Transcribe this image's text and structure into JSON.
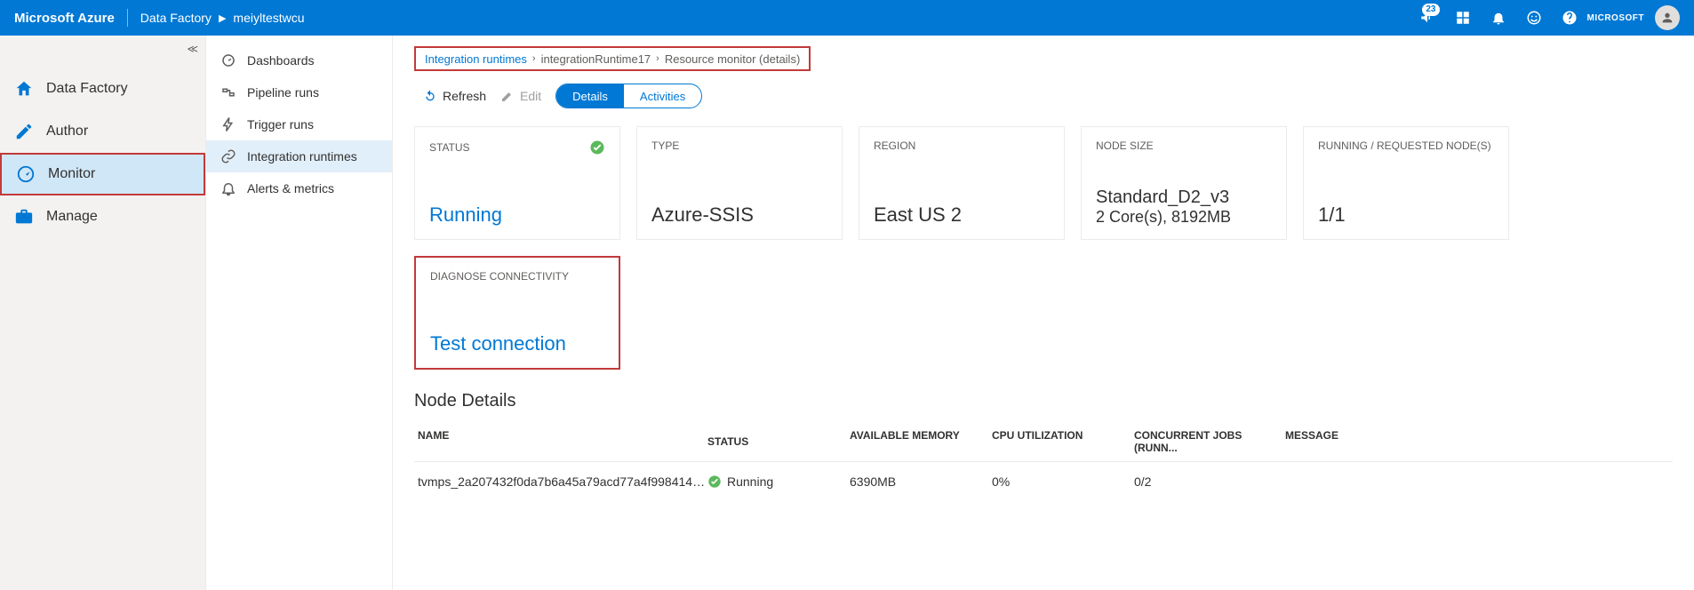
{
  "header": {
    "logo": "Microsoft Azure",
    "service": "Data Factory",
    "instance": "meiyltestwcu",
    "badge_count": "23",
    "tenant": "MICROSOFT"
  },
  "nav1": {
    "items": [
      {
        "label": "Data Factory"
      },
      {
        "label": "Author"
      },
      {
        "label": "Monitor"
      },
      {
        "label": "Manage"
      }
    ]
  },
  "nav2": {
    "items": [
      {
        "label": "Dashboards"
      },
      {
        "label": "Pipeline runs"
      },
      {
        "label": "Trigger runs"
      },
      {
        "label": "Integration runtimes"
      },
      {
        "label": "Alerts & metrics"
      }
    ]
  },
  "breadcrumb": {
    "a": "Integration runtimes",
    "b": "integrationRuntime17",
    "c": "Resource monitor (details)"
  },
  "toolbar": {
    "refresh": "Refresh",
    "edit": "Edit",
    "details": "Details",
    "activities": "Activities"
  },
  "cards": {
    "status_label": "STATUS",
    "status_value": "Running",
    "type_label": "TYPE",
    "type_value": "Azure-SSIS",
    "region_label": "REGION",
    "region_value": "East US 2",
    "nodesize_label": "NODE SIZE",
    "nodesize_value": "Standard_D2_v3",
    "nodesize_sub": "2 Core(s), 8192MB",
    "nodes_label": "RUNNING / REQUESTED NODE(S)",
    "nodes_value": "1/1",
    "diag_label": "DIAGNOSE CONNECTIVITY",
    "diag_value": "Test connection"
  },
  "node_details": {
    "title": "Node Details",
    "headers": {
      "name": "NAME",
      "status": "STATUS",
      "mem": "AVAILABLE MEMORY",
      "cpu": "CPU UTILIZATION",
      "jobs": "CONCURRENT JOBS (RUNN...",
      "msg": "MESSAGE"
    },
    "rows": [
      {
        "name": "tvmps_2a207432f0da7b6a45a79acd77a4f9984145...",
        "status": "Running",
        "mem": "6390MB",
        "cpu": "0%",
        "jobs": "0/2",
        "msg": ""
      }
    ]
  }
}
